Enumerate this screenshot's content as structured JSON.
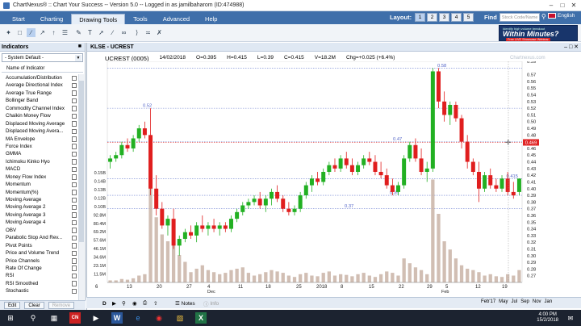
{
  "window": {
    "title": "ChartNexus® :: Chart Your Success -- Version 5.0 -- Logged in as jamilbaharom (ID:474988)"
  },
  "menu": {
    "tabs": [
      "Start",
      "Charting",
      "Drawing Tools",
      "Tools",
      "Advanced",
      "Help"
    ],
    "active_tab": "Drawing Tools"
  },
  "layout": {
    "label": "Layout:",
    "options": [
      "1",
      "2",
      "3",
      "4",
      "5"
    ],
    "selected": "1"
  },
  "find": {
    "label": "Find",
    "placeholder": "Stock Code/Name"
  },
  "language": {
    "label": "English"
  },
  "ad": {
    "line1": "Identify high volume breakout",
    "line2": "Within Minutes?",
    "line3": "Free LIVE Showcase Webinar"
  },
  "indicators_panel": {
    "title": "Indicators",
    "preset": "- System Default -",
    "column_header": "Name of Indicator",
    "items": [
      "Accumulation/Distribution",
      "Average Directional Index",
      "Average True Range",
      "Bollinger Band",
      "Commodity Channel Index",
      "Chaikin Money Flow",
      "Displaced Moving Average",
      "Displaced Moving Avera...",
      "MA Envelope",
      "Force Index",
      "GMMA",
      "Ichimoku Kinko Hyo",
      "MACD",
      "Money Flow Index",
      "Momentum",
      "Momentum(%)",
      "Moving Average",
      "Moving Average 2",
      "Moving Average 3",
      "Moving Average 4",
      "OBV",
      "Parabolic Stop And Rev...",
      "Pivot Points",
      "Price and Volume Trend",
      "Price Channels",
      "Rate Of Change",
      "RSI",
      "RSI Smoothed",
      "Stochastic"
    ],
    "buttons": [
      "Edit",
      "Clear",
      "Remove"
    ]
  },
  "chart_window": {
    "title": "KLSE - UCREST"
  },
  "quote": {
    "symbol": "UCREST (0005)",
    "date": "14/02/2018",
    "open": "O=0.395",
    "high": "H=0.415",
    "low": "L=0.39",
    "close": "C=0.415",
    "volume": "V=18.2M",
    "change": "Chg=+0.025 (+6.4%)"
  },
  "watermark": "Chartnexus.com",
  "chart_data": {
    "type": "candlestick",
    "ylim": [
      0.26,
      0.59
    ],
    "y_ticks": [
      "0.59",
      "0.57",
      "0.56",
      "0.55",
      "0.54",
      "0.53",
      "0.52",
      "0.51",
      "0.50",
      "0.49",
      "0.48",
      "0.47",
      "0.46",
      "0.45",
      "0.44",
      "0.43",
      "0.42",
      "0.41",
      "0.40",
      "0.39",
      "0.38",
      "0.37",
      "0.36",
      "0.35",
      "0.34",
      "0.33",
      "0.32",
      "0.31",
      "0.30",
      "0.29",
      "0.28",
      "0.27"
    ],
    "current_price": "0.469",
    "level_labels": [
      "0.58",
      "0.52",
      "0.47",
      "0.415",
      "0.39",
      "0.37"
    ],
    "volume_ticks": [
      "0.15B",
      "0.14B",
      "0.13B",
      "0.12B",
      "0.10B",
      "92.8M",
      "80.4M",
      "69.2M",
      "57.6M",
      "46.1M",
      "34.6M",
      "23.1M",
      "11.5M"
    ],
    "x_ticks": [
      "6",
      "13",
      "20",
      "27",
      "4",
      "11",
      "18",
      "25",
      "2018",
      "8",
      "15",
      "22",
      "29",
      "5",
      "12",
      "19"
    ],
    "month_labels": [
      "Dec",
      "Feb"
    ],
    "candles": [
      [
        0.44,
        0.45,
        0.43,
        0.445
      ],
      [
        0.445,
        0.455,
        0.44,
        0.45
      ],
      [
        0.45,
        0.47,
        0.445,
        0.465
      ],
      [
        0.465,
        0.475,
        0.455,
        0.46
      ],
      [
        0.46,
        0.48,
        0.455,
        0.475
      ],
      [
        0.475,
        0.495,
        0.47,
        0.49
      ],
      [
        0.49,
        0.5,
        0.475,
        0.48
      ],
      [
        0.48,
        0.52,
        0.39,
        0.4
      ],
      [
        0.4,
        0.42,
        0.36,
        0.37
      ],
      [
        0.37,
        0.38,
        0.34,
        0.345
      ],
      [
        0.345,
        0.36,
        0.33,
        0.355
      ],
      [
        0.355,
        0.37,
        0.31,
        0.315
      ],
      [
        0.315,
        0.33,
        0.3,
        0.325
      ],
      [
        0.325,
        0.34,
        0.32,
        0.335
      ],
      [
        0.335,
        0.345,
        0.325,
        0.33
      ],
      [
        0.33,
        0.35,
        0.32,
        0.345
      ],
      [
        0.345,
        0.36,
        0.335,
        0.34
      ],
      [
        0.34,
        0.35,
        0.33,
        0.345
      ],
      [
        0.345,
        0.355,
        0.335,
        0.34
      ],
      [
        0.34,
        0.35,
        0.33,
        0.345
      ],
      [
        0.345,
        0.35,
        0.335,
        0.34
      ],
      [
        0.34,
        0.36,
        0.335,
        0.355
      ],
      [
        0.355,
        0.37,
        0.35,
        0.365
      ],
      [
        0.365,
        0.38,
        0.36,
        0.375
      ],
      [
        0.375,
        0.385,
        0.37,
        0.38
      ],
      [
        0.38,
        0.39,
        0.375,
        0.385
      ],
      [
        0.385,
        0.395,
        0.37,
        0.375
      ],
      [
        0.375,
        0.39,
        0.365,
        0.385
      ],
      [
        0.385,
        0.4,
        0.375,
        0.395
      ],
      [
        0.395,
        0.405,
        0.38,
        0.385
      ],
      [
        0.385,
        0.39,
        0.365,
        0.37
      ],
      [
        0.37,
        0.38,
        0.36,
        0.365
      ],
      [
        0.365,
        0.375,
        0.36,
        0.37
      ],
      [
        0.37,
        0.395,
        0.365,
        0.39
      ],
      [
        0.39,
        0.41,
        0.385,
        0.405
      ],
      [
        0.405,
        0.42,
        0.395,
        0.415
      ],
      [
        0.415,
        0.425,
        0.405,
        0.41
      ],
      [
        0.41,
        0.43,
        0.405,
        0.425
      ],
      [
        0.425,
        0.44,
        0.42,
        0.435
      ],
      [
        0.435,
        0.445,
        0.425,
        0.43
      ],
      [
        0.43,
        0.45,
        0.425,
        0.445
      ],
      [
        0.445,
        0.455,
        0.43,
        0.435
      ],
      [
        0.435,
        0.445,
        0.42,
        0.425
      ],
      [
        0.425,
        0.44,
        0.42,
        0.435
      ],
      [
        0.435,
        0.45,
        0.43,
        0.445
      ],
      [
        0.445,
        0.455,
        0.435,
        0.44
      ],
      [
        0.44,
        0.45,
        0.42,
        0.425
      ],
      [
        0.425,
        0.44,
        0.415,
        0.42
      ],
      [
        0.42,
        0.43,
        0.4,
        0.405
      ],
      [
        0.405,
        0.415,
        0.39,
        0.395
      ],
      [
        0.395,
        0.41,
        0.39,
        0.405
      ],
      [
        0.405,
        0.45,
        0.4,
        0.445
      ],
      [
        0.445,
        0.47,
        0.44,
        0.465
      ],
      [
        0.465,
        0.475,
        0.44,
        0.445
      ],
      [
        0.445,
        0.46,
        0.42,
        0.425
      ],
      [
        0.425,
        0.44,
        0.41,
        0.43
      ],
      [
        0.43,
        0.58,
        0.425,
        0.575
      ],
      [
        0.575,
        0.58,
        0.52,
        0.53
      ],
      [
        0.53,
        0.545,
        0.5,
        0.51
      ],
      [
        0.51,
        0.53,
        0.495,
        0.525
      ],
      [
        0.525,
        0.53,
        0.5,
        0.505
      ],
      [
        0.505,
        0.51,
        0.46,
        0.47
      ],
      [
        0.47,
        0.48,
        0.43,
        0.44
      ],
      [
        0.44,
        0.445,
        0.42,
        0.425
      ],
      [
        0.425,
        0.44,
        0.38,
        0.4
      ],
      [
        0.4,
        0.425,
        0.395,
        0.42
      ],
      [
        0.42,
        0.43,
        0.4,
        0.405
      ],
      [
        0.405,
        0.415,
        0.395,
        0.4
      ],
      [
        0.4,
        0.42,
        0.395,
        0.415
      ],
      [
        0.415,
        0.425,
        0.39,
        0.395
      ],
      [
        0.395,
        0.41,
        0.385,
        0.39
      ],
      [
        0.395,
        0.415,
        0.39,
        0.415
      ]
    ],
    "volume_M": [
      3,
      3,
      5,
      4,
      6,
      10,
      12,
      140,
      95,
      70,
      60,
      65,
      40,
      30,
      15,
      20,
      25,
      18,
      15,
      12,
      14,
      18,
      20,
      22,
      14,
      10,
      12,
      15,
      18,
      16,
      14,
      10,
      8,
      12,
      14,
      10,
      9,
      14,
      16,
      10,
      12,
      11,
      9,
      12,
      14,
      10,
      8,
      12,
      16,
      14,
      10,
      35,
      28,
      22,
      18,
      12,
      150,
      100,
      60,
      48,
      35,
      25,
      20,
      18,
      15,
      10,
      12,
      9,
      8,
      12,
      10,
      18
    ]
  },
  "bottom": {
    "notes": "Notes",
    "info": "Info",
    "timeline": [
      "Feb'17",
      "May",
      "Jul",
      "Sep",
      "Nov",
      "Jan"
    ]
  },
  "taskbar": {
    "time": "4:00 PM",
    "date": "15/2/2018"
  },
  "colors": {
    "menu_bg": "#3f6faa",
    "up": "#22b022",
    "down": "#e01e1e",
    "volume": "#c9b3a6"
  }
}
